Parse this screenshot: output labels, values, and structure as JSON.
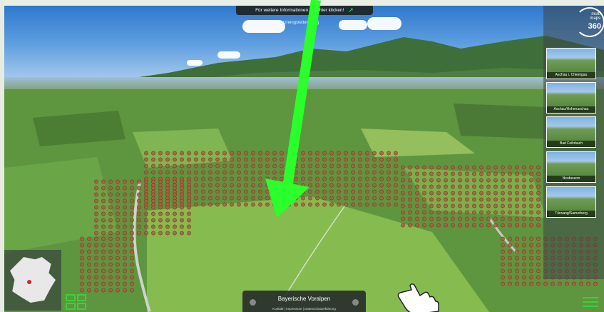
{
  "banner": {
    "text": "Für weitere Informationen bitte hier klicken!",
    "sub_text": "Greingstetten/Berg"
  },
  "logo": {
    "line1": "multi",
    "line2": "maps",
    "line3": "360"
  },
  "thumbnails": [
    {
      "caption": "Aschau i. Chiemgau"
    },
    {
      "caption": "Aschau/Hohenaschau"
    },
    {
      "caption": "Bad Feilnbach"
    },
    {
      "caption": "Neubeuern"
    },
    {
      "caption": "Törwang/Samerberg"
    }
  ],
  "bottom_bar": {
    "title": "Bayerische Voralpen",
    "links": "Kontakt | Impressum | Datenschutzerklärung"
  },
  "colors": {
    "accent_green": "#3cd03c",
    "arrow_green": "#2bff2b",
    "panel_dark": "#1f2a33"
  },
  "icons": {
    "grid": "grid-icon",
    "menu": "hamburger-icon",
    "cursor": "hand-cursor-icon",
    "minimap_pin": "location-dot-icon"
  }
}
